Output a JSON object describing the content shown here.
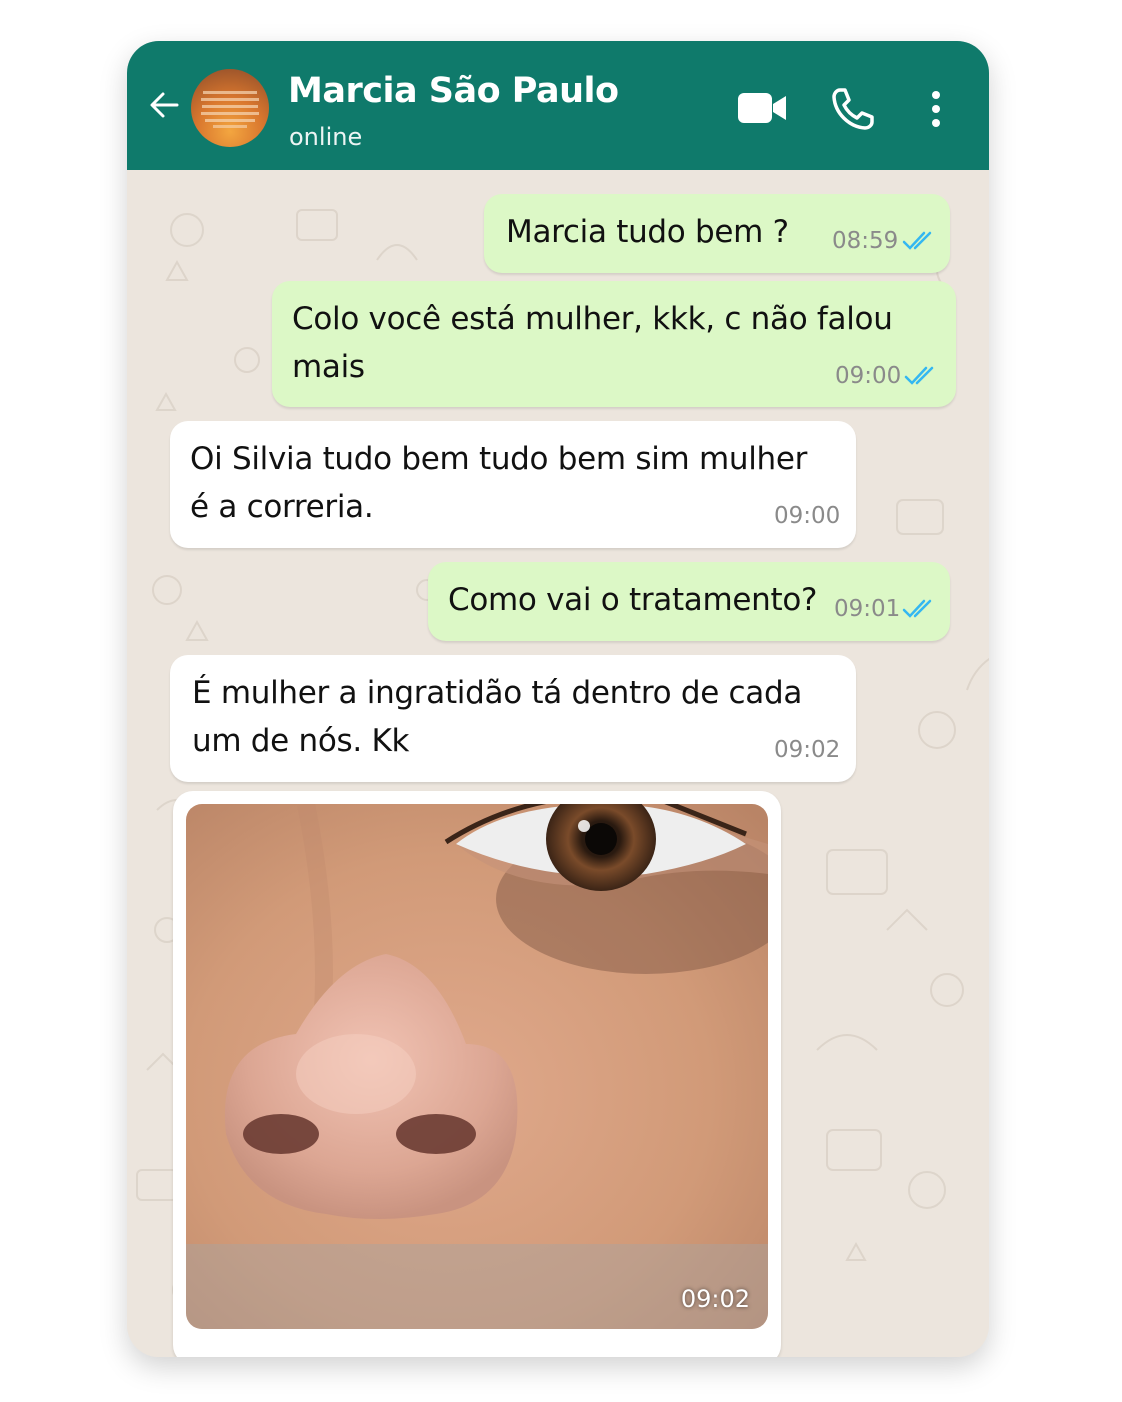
{
  "header": {
    "contact_name": "Marcia São Paulo",
    "status": "online",
    "bar_color": "#0f7a6b",
    "icons": [
      "back-arrow-icon",
      "avatar",
      "video-call-icon",
      "phone-icon",
      "more-options-icon"
    ]
  },
  "messages": [
    {
      "direction": "outgoing",
      "text": "Marcia tudo bem ?",
      "time": "08:59",
      "read": true
    },
    {
      "direction": "outgoing",
      "text": "Colo você está mulher, kkk, c não falou\nmais",
      "time": "09:00",
      "read": true
    },
    {
      "direction": "incoming",
      "text": "Oi Silvia tudo bem tudo bem sim mulher\né a correria.",
      "time": "09:00"
    },
    {
      "direction": "outgoing",
      "text": "Como vai o tratamento?",
      "time": "09:01",
      "read": true
    },
    {
      "direction": "incoming",
      "text": "É mulher a ingratidão tá dentro de cada\num de nós. Kk",
      "time": "09:02"
    }
  ],
  "photo_message": {
    "direction": "incoming",
    "time": "09:02"
  },
  "colors": {
    "outgoing_bubble": "#dcf8c6",
    "incoming_bubble": "#ffffff",
    "chat_background": "#ece5dd",
    "read_ticks": "#34b7f1"
  }
}
